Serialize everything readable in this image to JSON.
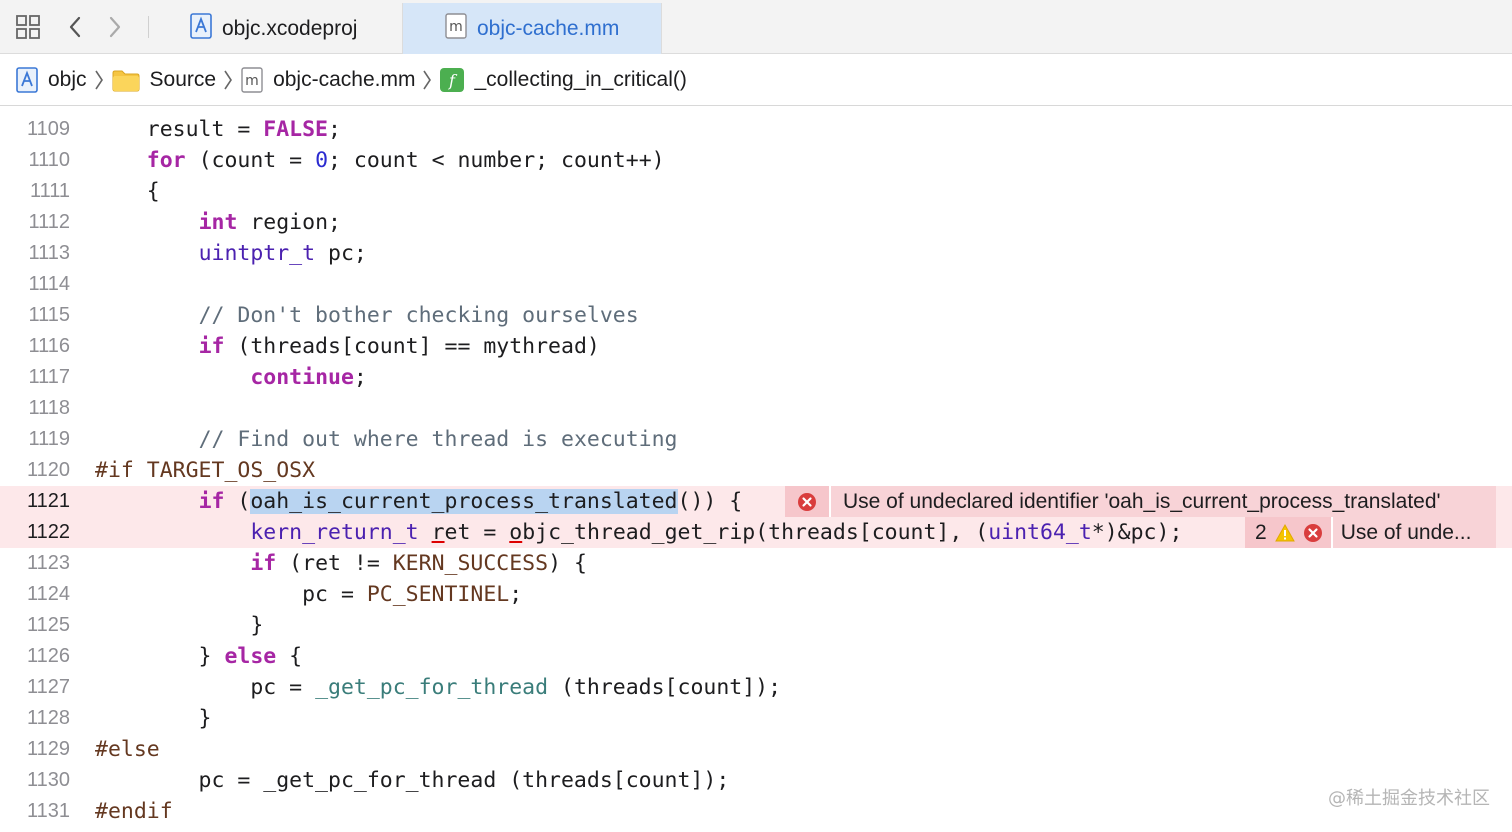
{
  "tabs": [
    {
      "label": "objc.xcodeproj",
      "active": false,
      "icon": "xcode-project-icon"
    },
    {
      "label": "objc-cache.mm",
      "active": true,
      "icon": "objc-source-file-icon"
    }
  ],
  "breadcrumb": {
    "items": [
      {
        "label": "objc",
        "icon": "xcode-project-icon"
      },
      {
        "label": "Source",
        "icon": "folder-icon"
      },
      {
        "label": "objc-cache.mm",
        "icon": "objc-source-file-icon"
      },
      {
        "label": "_collecting_in_critical()",
        "icon": "function-icon"
      }
    ]
  },
  "editor": {
    "line_numbers": [
      "1109",
      "1110",
      "1111",
      "1112",
      "1113",
      "1114",
      "1115",
      "1116",
      "1117",
      "1118",
      "1119",
      "1120",
      "1121",
      "1122",
      "1123",
      "1124",
      "1125",
      "1126",
      "1127",
      "1128",
      "1129",
      "1130",
      "1131"
    ],
    "current_line": "1121",
    "errors": {
      "line_1121": "Use of undeclared identifier 'oah_is_current_process_translated'",
      "line_1122_count": "2",
      "line_1122": "Use of unde..."
    }
  },
  "colors": {
    "keyword": "#a626a4",
    "type": "#4b21b0",
    "comment": "#5f6d7a",
    "preprocessor": "#643820",
    "error_background": "#f8d3d7",
    "active_tab": "#d6e6f8"
  },
  "watermark": "@稀土掘金技术社区"
}
